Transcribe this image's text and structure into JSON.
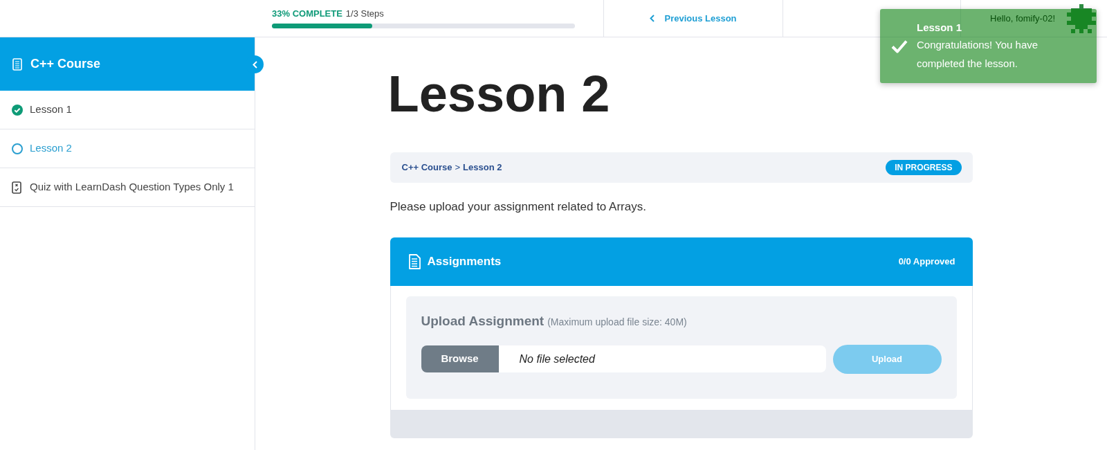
{
  "progress": {
    "label": "33% COMPLETE",
    "steps": "1/3 Steps",
    "level": 0.33
  },
  "header_nav": {
    "previous_lesson": "Previous Lesson",
    "greeting": "Hello, fomify-02!"
  },
  "toast": {
    "title": "Lesson 1",
    "message": "Congratulations! You have completed the lesson."
  },
  "sidebar": {
    "course_title": "C++ Course",
    "items": [
      {
        "label": "Lesson 1",
        "kind": "lesson",
        "completed": true,
        "selected": false
      },
      {
        "label": "Lesson 2",
        "kind": "lesson",
        "completed": false,
        "selected": true
      },
      {
        "label": "Quiz with LearnDash Question Types Only 1",
        "kind": "quiz",
        "completed": false,
        "selected": false
      }
    ]
  },
  "lesson": {
    "title": "Lesson 2",
    "breadcrumb": {
      "items": [
        "C++ Course",
        "Lesson 2"
      ],
      "separator": ">"
    },
    "status_badge": "IN PROGRESS",
    "description": "Please upload your assignment related to Arrays."
  },
  "assignments": {
    "title": "Assignments",
    "approved": "0/0 Approved",
    "upload": {
      "title": "Upload Assignment",
      "note": "(Maximum upload file size: 40M)",
      "browse_button": "Browse",
      "file_value": "No file selected",
      "upload_button": {
        "label": "Upload",
        "disabled": true
      }
    }
  }
}
